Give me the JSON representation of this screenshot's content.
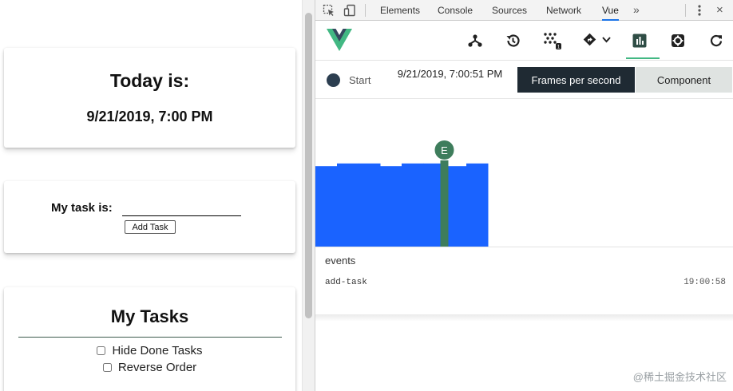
{
  "app": {
    "date_card": {
      "title": "Today is:",
      "date": "9/21/2019, 7:00 PM"
    },
    "task_card": {
      "label": "My task is:",
      "input_value": "",
      "add_button_label": "Add Task"
    },
    "list_card": {
      "title": "My Tasks",
      "options": [
        {
          "label": "Hide Done Tasks",
          "checked": false
        },
        {
          "label": "Reverse Order",
          "checked": false
        }
      ]
    }
  },
  "devtools": {
    "tabs": [
      "Elements",
      "Console",
      "Sources",
      "Network",
      "Vue"
    ],
    "active_tab": "Vue",
    "more_label": "»",
    "close_label": "×",
    "vue_toolbar": {
      "icons": [
        "components-tree-icon",
        "history-icon",
        "vuex-icon",
        "router-icon",
        "performance-icon",
        "settings-icon",
        "refresh-icon"
      ],
      "active": "performance-icon",
      "badge_count": "1"
    },
    "timeline": {
      "start_label": "Start",
      "time": "9/21/2019, 7:00:51 PM",
      "fps_button": "Frames per second",
      "component_button": "Component"
    },
    "events": {
      "header": "events",
      "rows": [
        {
          "name": "add-task",
          "time": "19:00:58"
        }
      ]
    },
    "colors": {
      "fps_bar": "#1a63ff",
      "event_marker": "#3e7d5c",
      "accent": "#42b883"
    }
  },
  "chart_data": {
    "type": "bar",
    "x": [
      0,
      1,
      2,
      3,
      4,
      5,
      6,
      7
    ],
    "values": [
      60,
      62,
      62,
      60,
      62,
      62,
      60,
      62
    ],
    "markers": [
      {
        "x": 4.5,
        "label": "E"
      }
    ]
  },
  "watermark": "@稀土掘金技术社区"
}
